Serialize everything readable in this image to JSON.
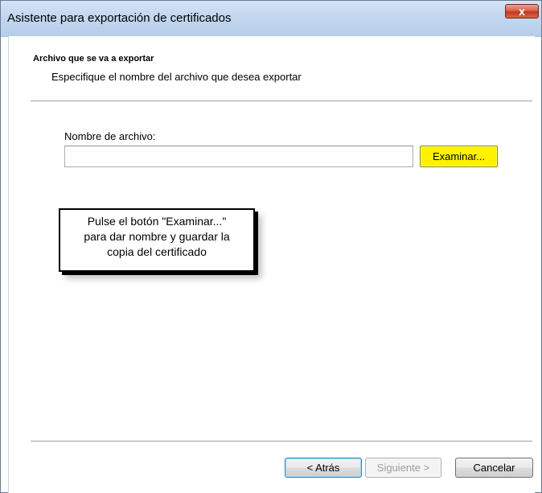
{
  "window": {
    "title": "Asistente para exportación de certificados",
    "close_symbol": "x"
  },
  "header": {
    "title": "Archivo que se va a exportar",
    "description": "Especifique el nombre del archivo que desea exportar"
  },
  "form": {
    "file_label": "Nombre de archivo:",
    "file_value": "",
    "browse_label": "Examinar..."
  },
  "callout": {
    "lines": [
      "Pulse el botón \"Examinar...\"",
      "para dar nombre y guardar la",
      "copia del certificado"
    ]
  },
  "footer": {
    "back_label": "< Atrás",
    "next_label": "Siguiente >",
    "cancel_label": "Cancelar"
  },
  "colors": {
    "highlight": "#fef200",
    "title_bar": "#c3d7ef",
    "close_button": "#c2371e"
  },
  "icons": {
    "close": "close-icon"
  }
}
